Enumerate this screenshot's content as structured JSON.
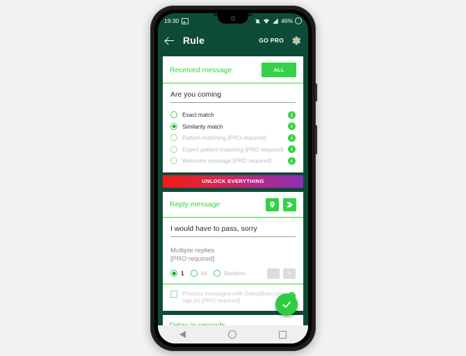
{
  "status_bar": {
    "time": "19:30",
    "left_icons": [
      "screenshot-icon"
    ],
    "right_icons": [
      "notification-silent-icon",
      "wifi-icon",
      "signal-icon"
    ],
    "battery_percent": "46%"
  },
  "app_bar": {
    "back_icon": "back-arrow-icon",
    "title": "Rule",
    "go_pro_label": "GO PRO",
    "settings_icon": "gear-bolt-icon"
  },
  "received_message": {
    "section_title": "Received message",
    "all_button_label": "ALL",
    "message_value": "Are you coming",
    "message_placeholder": "Received message",
    "options": [
      {
        "label": "Exact match",
        "selected": false,
        "disabled": false
      },
      {
        "label": "Similarity match",
        "selected": true,
        "disabled": false
      },
      {
        "label": "Pattern matching [PRO required]",
        "selected": false,
        "disabled": true
      },
      {
        "label": "Expert pattern matching [PRO required]",
        "selected": false,
        "disabled": true
      },
      {
        "label": "Welcome message [PRO required]",
        "selected": false,
        "disabled": true
      }
    ],
    "info_glyph": "i"
  },
  "unlock_banner": {
    "label": "UNLOCK EVERYTHING",
    "gradient_start": "#f41a1a",
    "gradient_end": "#8e2fb6"
  },
  "reply_message": {
    "section_title": "Reply message",
    "action_icons": [
      "location-pin-icon",
      "tag-icon"
    ],
    "reply_value": "I would have to pass, sorry",
    "reply_placeholder": "Reply message"
  },
  "multiple_replies": {
    "title_line1": "Multiple replies",
    "title_line2": "[PRO required]",
    "options": [
      {
        "label": "1",
        "selected": true,
        "disabled": false
      },
      {
        "label": "All",
        "selected": false,
        "disabled": true
      },
      {
        "label": "Random",
        "selected": false,
        "disabled": true
      }
    ],
    "stepper_minus": "-",
    "stepper_plus": "+"
  },
  "dialogflow": {
    "label": "Process messages with Dialogflow.com (api.ai) [PRO required]",
    "checked": false,
    "info_glyph": "i"
  },
  "delay": {
    "section_title": "Delay in seconds",
    "placeholder": "Delay in seconds"
  },
  "fab": {
    "icon": "check-icon"
  },
  "nav_bar": {
    "items": [
      "back-nav-icon",
      "home-nav-icon",
      "recents-nav-icon"
    ]
  },
  "colors": {
    "header_green": "#0d4b38",
    "accent_green": "#35d247",
    "fab_green": "#2ecc40",
    "disabled_gray": "#bdbdbd"
  }
}
